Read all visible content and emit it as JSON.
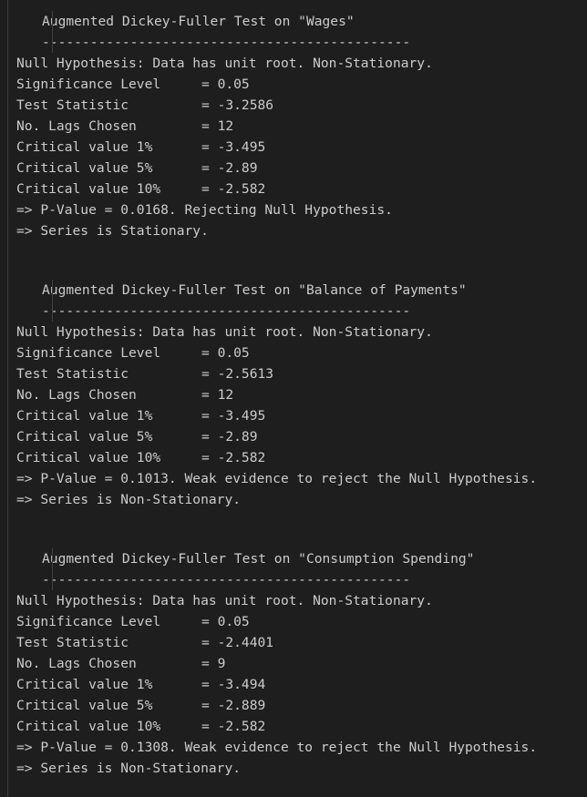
{
  "separator": "----------------------------------------------",
  "tests": [
    {
      "title": "Augmented Dickey-Fuller Test on \"Wages\"",
      "null_hypothesis": "Null Hypothesis: Data has unit root. Non-Stationary.",
      "rows": [
        {
          "label": "Significance Level",
          "value": "= 0.05"
        },
        {
          "label": "Test Statistic",
          "value": "= -3.2586"
        },
        {
          "label": "No. Lags Chosen",
          "value": "= 12"
        },
        {
          "label": "Critical value 1%",
          "value": "= -3.495"
        },
        {
          "label": "Critical value 5%",
          "value": "= -2.89"
        },
        {
          "label": "Critical value 10%",
          "value": "= -2.582"
        }
      ],
      "p_value_line": "=> P-Value = 0.0168. Rejecting Null Hypothesis.",
      "conclusion": "=> Series is Stationary."
    },
    {
      "title": "Augmented Dickey-Fuller Test on \"Balance of Payments\"",
      "null_hypothesis": "Null Hypothesis: Data has unit root. Non-Stationary.",
      "rows": [
        {
          "label": "Significance Level",
          "value": "= 0.05"
        },
        {
          "label": "Test Statistic",
          "value": "= -2.5613"
        },
        {
          "label": "No. Lags Chosen",
          "value": "= 12"
        },
        {
          "label": "Critical value 1%",
          "value": "= -3.495"
        },
        {
          "label": "Critical value 5%",
          "value": "= -2.89"
        },
        {
          "label": "Critical value 10%",
          "value": "= -2.582"
        }
      ],
      "p_value_line": "=> P-Value = 0.1013. Weak evidence to reject the Null Hypothesis.",
      "conclusion": "=> Series is Non-Stationary."
    },
    {
      "title": "Augmented Dickey-Fuller Test on \"Consumption Spending\"",
      "null_hypothesis": "Null Hypothesis: Data has unit root. Non-Stationary.",
      "rows": [
        {
          "label": "Significance Level",
          "value": "= 0.05"
        },
        {
          "label": "Test Statistic",
          "value": "= -2.4401"
        },
        {
          "label": "No. Lags Chosen",
          "value": "= 9"
        },
        {
          "label": "Critical value 1%",
          "value": "= -3.494"
        },
        {
          "label": "Critical value 5%",
          "value": "= -2.889"
        },
        {
          "label": "Critical value 10%",
          "value": "= -2.582"
        }
      ],
      "p_value_line": "=> P-Value = 0.1308. Weak evidence to reject the Null Hypothesis.",
      "conclusion": "=> Series is Non-Stationary."
    }
  ]
}
